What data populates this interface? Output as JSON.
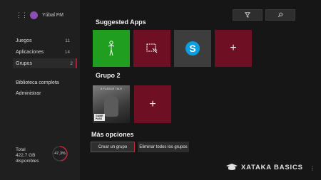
{
  "profile": {
    "name": "Yúbal FM"
  },
  "sidebar": {
    "items": [
      {
        "label": "Juegos",
        "count": "11"
      },
      {
        "label": "Aplicaciones",
        "count": "14"
      },
      {
        "label": "Grupos",
        "count": "2"
      },
      {
        "label": "Biblioteca completa",
        "count": ""
      },
      {
        "label": "Administrar",
        "count": ""
      }
    ],
    "storage": {
      "total_label": "Total",
      "amount": "422,7 GB",
      "available_label": "disponibles",
      "percent_text": "47,3%",
      "percent_value": 47.3
    }
  },
  "topbar": {
    "filter_icon": "filter-icon",
    "search_icon": "search-icon"
  },
  "sections": {
    "suggested": {
      "title": "Suggested Apps"
    },
    "group2": {
      "title": "Grupo 2"
    },
    "more": {
      "title": "Más opciones"
    }
  },
  "game": {
    "art_title": "A PLAGUE TALE",
    "badge_line1": "GAME",
    "badge_line2": "PASS"
  },
  "buttons": {
    "create_group": "Crear un grupo",
    "delete_groups": "Eliminar todos los grupos"
  },
  "watermark": {
    "text": "XATAKA BASICS"
  },
  "colors": {
    "accent": "#b01c39",
    "tile_red": "#6e0f23",
    "tile_green": "#1f9e1f"
  }
}
